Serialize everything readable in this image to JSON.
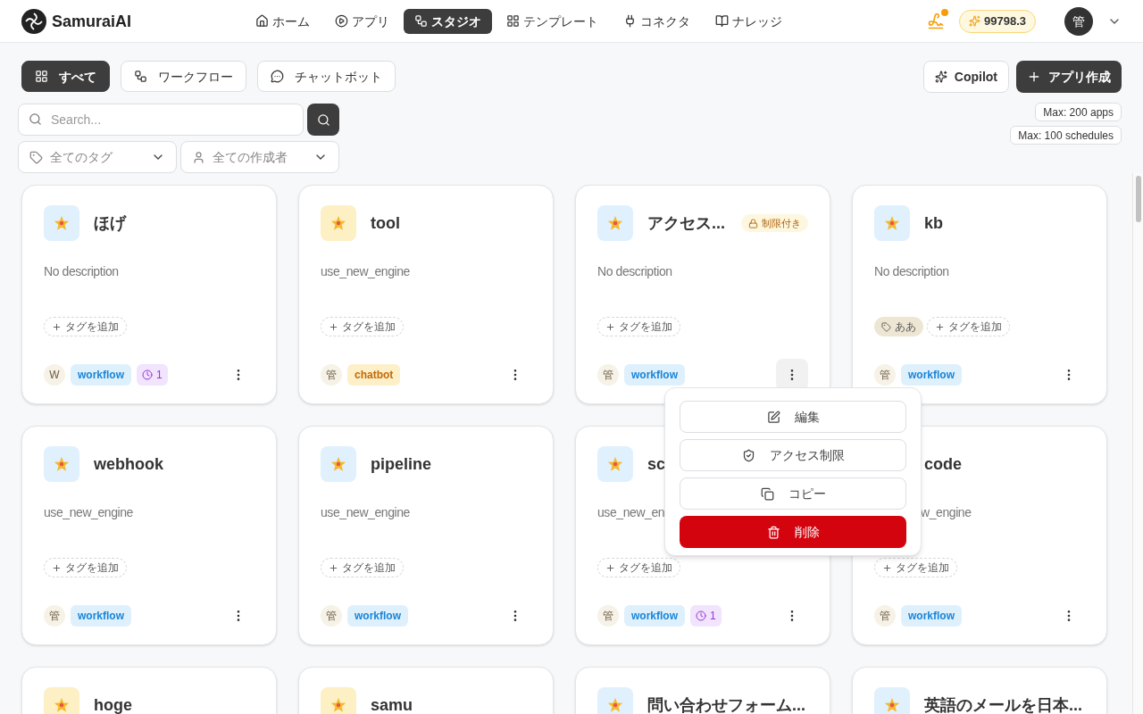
{
  "header": {
    "logo": "SamuraiAI",
    "nav": [
      {
        "label": "ホーム",
        "selected": false
      },
      {
        "label": "アプリ",
        "selected": false
      },
      {
        "label": "スタジオ",
        "selected": true
      },
      {
        "label": "テンプレート",
        "selected": false
      },
      {
        "label": "コネクタ",
        "selected": false
      },
      {
        "label": "ナレッジ",
        "selected": false
      }
    ],
    "credits": "99798.3",
    "avatar": "管"
  },
  "filters": [
    {
      "label": "すべて",
      "selected": true
    },
    {
      "label": "ワークフロー",
      "selected": false
    },
    {
      "label": "チャットボット",
      "selected": false
    }
  ],
  "actions": {
    "copilot": "Copilot",
    "create": "アプリ作成"
  },
  "search": {
    "placeholder": "Search..."
  },
  "dropdowns": [
    "全てのタグ",
    "全ての作成者"
  ],
  "limits": [
    "Max: 200 apps",
    "Max: 100 schedules"
  ],
  "cards": [
    {
      "title": "ほげ",
      "color": "#e0f0fd",
      "description": "No description",
      "add_tag": "タグを追加",
      "author": "W",
      "type": "workflow",
      "schedule": "1",
      "menu_open": false
    },
    {
      "title": "tool",
      "color": "#fdf0c4",
      "description": "use_new_engine",
      "add_tag": "タグを追加",
      "author": "管",
      "type": "chatbot",
      "menu_open": false
    },
    {
      "title": "アクセス...",
      "color": "#e0f0fd",
      "restricted": "制限付き",
      "description": "No description",
      "add_tag": "タグを追加",
      "author": "管",
      "type": "workflow",
      "menu_open": true
    },
    {
      "title": "kb",
      "color": "#e0f0fd",
      "description": "No description",
      "tags": [
        "ああ"
      ],
      "add_tag": "タグを追加",
      "author": "管",
      "type": "workflow",
      "menu_open": false
    },
    {
      "title": "webhook",
      "color": "#e0f0fd",
      "description": "use_new_engine",
      "add_tag": "タグを追加",
      "author": "管",
      "type": "workflow",
      "menu_open": false
    },
    {
      "title": "pipeline",
      "color": "#e0f0fd",
      "description": "use_new_engine",
      "add_tag": "タグを追加",
      "author": "管",
      "type": "workflow",
      "menu_open": false
    },
    {
      "title": "sc",
      "color": "#e0f0fd",
      "description": "use_new_en",
      "add_tag": "タグを追加",
      "author": "管",
      "type": "workflow",
      "schedule": "1",
      "menu_open": false
    },
    {
      "title": "code",
      "covered": true,
      "description": "w_engine",
      "add_tag": "タグを追加",
      "author": "管",
      "type": "workflow",
      "menu_open": false
    },
    {
      "title": "hoge",
      "color": "#fdf0c4"
    },
    {
      "title": "samu",
      "color": "#fdf0c4"
    },
    {
      "title": "問い合わせフォーム...",
      "color": "#e0f0fd"
    },
    {
      "title": "英語のメールを日本...",
      "color": "#e0f0fd"
    }
  ],
  "menu": [
    {
      "label": "編集",
      "kind": "edit"
    },
    {
      "label": "アクセス制限",
      "kind": "access"
    },
    {
      "label": "コピー",
      "kind": "copy"
    },
    {
      "label": "削除",
      "kind": "delete"
    }
  ]
}
